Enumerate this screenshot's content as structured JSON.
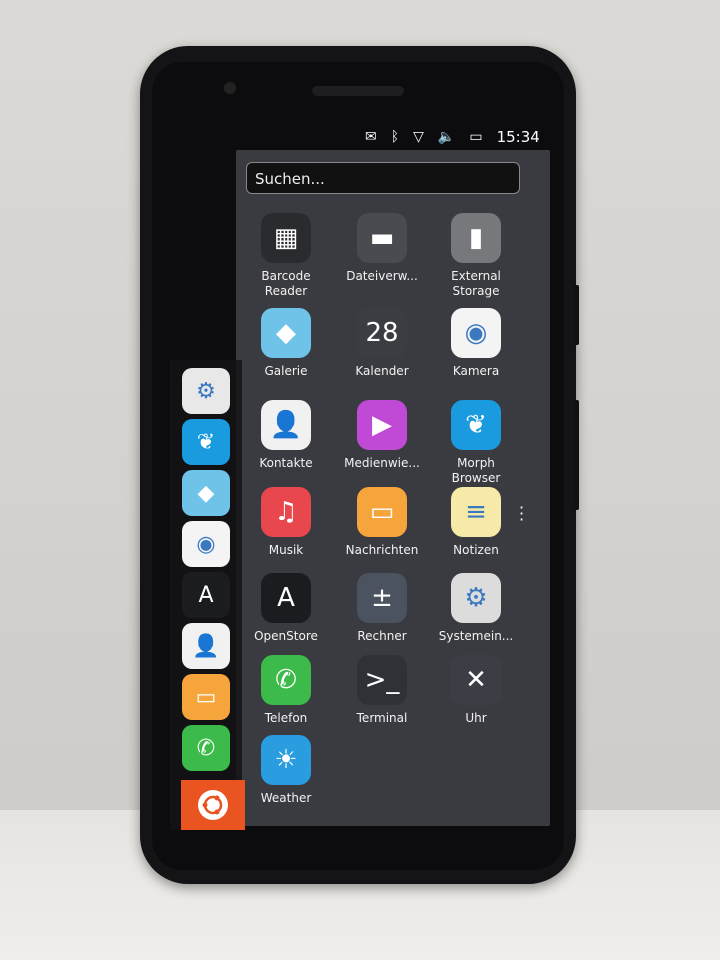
{
  "status_bar": {
    "time": "15:34",
    "icons": [
      "mail-icon",
      "bluetooth-icon",
      "wifi-icon",
      "volume-icon",
      "battery-icon"
    ]
  },
  "search": {
    "placeholder": "Suchen..."
  },
  "apps": [
    {
      "label": "Barcode Reader",
      "icon": "qr-code-icon",
      "color": "#2a2b2f",
      "glyph": "▦"
    },
    {
      "label": "Dateiverw...",
      "icon": "folder-icon",
      "color": "#4a4b50",
      "glyph": "▬"
    },
    {
      "label": "External Storage",
      "icon": "sd-card-icon",
      "color": "#77787c",
      "glyph": "▮"
    },
    {
      "label": "Galerie",
      "icon": "gallery-icon",
      "color": "#6fc3e8",
      "glyph": "◆"
    },
    {
      "label": "Kalender",
      "icon": "calendar-icon",
      "color": "#3c3d42",
      "glyph": "28"
    },
    {
      "label": "Kamera",
      "icon": "camera-icon",
      "color": "#f4f4f4",
      "glyph": "◉"
    },
    {
      "label": "Kontakte",
      "icon": "contacts-icon",
      "color": "#f1f1f1",
      "glyph": "👤"
    },
    {
      "label": "Medienwie...",
      "icon": "media-player-icon",
      "color": "#c04ad6",
      "glyph": "▶"
    },
    {
      "label": "Morph Browser",
      "icon": "morph-browser-icon",
      "color": "#1a9be0",
      "glyph": "❦"
    },
    {
      "label": "Musik",
      "icon": "music-icon",
      "color": "#e8484d",
      "glyph": "♫"
    },
    {
      "label": "Nachrichten",
      "icon": "messages-icon",
      "color": "#f5a53b",
      "glyph": "▭"
    },
    {
      "label": "Notizen",
      "icon": "notes-icon",
      "color": "#f7e9a8",
      "glyph": "≡"
    },
    {
      "label": "OpenStore",
      "icon": "openstore-icon",
      "color": "#1b1c1f",
      "glyph": "A"
    },
    {
      "label": "Rechner",
      "icon": "calculator-icon",
      "color": "#4b5260",
      "glyph": "±"
    },
    {
      "label": "Systemein...",
      "icon": "settings-icon",
      "color": "#dcdcdc",
      "glyph": "⚙"
    },
    {
      "label": "Telefon",
      "icon": "phone-icon",
      "color": "#3dbb4a",
      "glyph": "✆"
    },
    {
      "label": "Terminal",
      "icon": "terminal-icon",
      "color": "#303136",
      "glyph": ">_"
    },
    {
      "label": "Uhr",
      "icon": "clock-icon",
      "color": "#3c3e46",
      "glyph": "✕"
    },
    {
      "label": "Weather",
      "icon": "weather-icon",
      "color": "#2a9de0",
      "glyph": "☀"
    }
  ],
  "launcher": [
    {
      "icon": "settings-icon",
      "color": "#e8e8e8",
      "glyph": "⚙"
    },
    {
      "icon": "morph-browser-icon",
      "color": "#1a9be0",
      "glyph": "❦"
    },
    {
      "icon": "gallery-icon",
      "color": "#6fc3e8",
      "glyph": "◆"
    },
    {
      "icon": "camera-icon",
      "color": "#f4f4f4",
      "glyph": "◉"
    },
    {
      "icon": "openstore-icon",
      "color": "#1b1c1f",
      "glyph": "A"
    },
    {
      "icon": "contacts-icon",
      "color": "#f1f1f1",
      "glyph": "👤"
    },
    {
      "icon": "messages-icon",
      "color": "#f5a53b",
      "glyph": "▭"
    },
    {
      "icon": "phone-icon",
      "color": "#3dbb4a",
      "glyph": "✆"
    }
  ],
  "launcher_home": {
    "icon": "ubuntu-logo-icon",
    "color": "#e95420"
  }
}
